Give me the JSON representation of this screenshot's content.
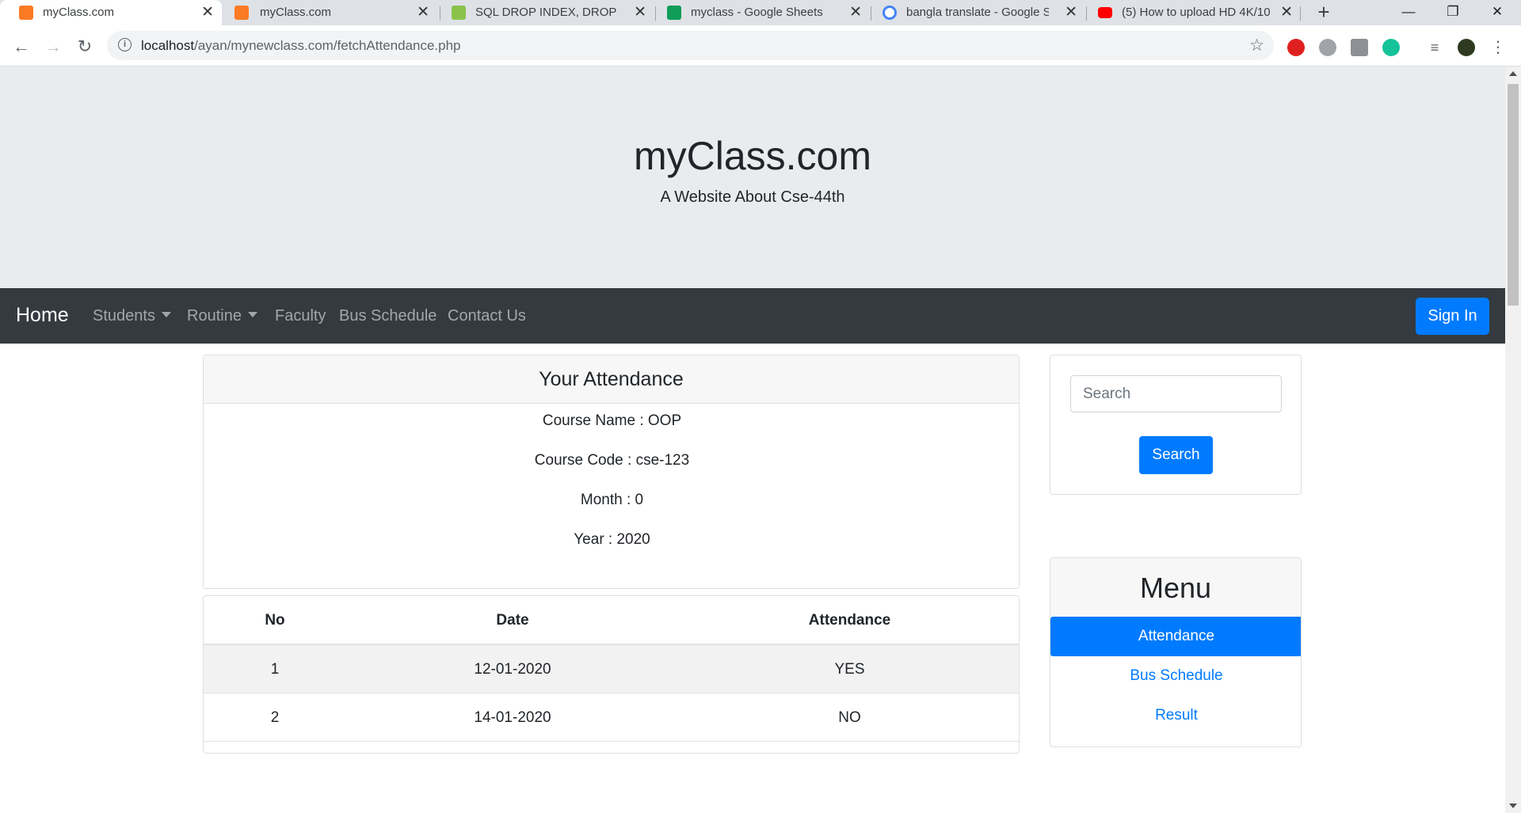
{
  "browser": {
    "tabs": [
      {
        "title": "myClass.com",
        "icon": "xampp-icon",
        "color": "#fb7a24"
      },
      {
        "title": "myClass.com",
        "icon": "xampp-icon",
        "color": "#fb7a24"
      },
      {
        "title": "SQL DROP INDEX, DROP TAB",
        "icon": "w3schools-icon",
        "color": "#8bc34a"
      },
      {
        "title": "myclass - Google Sheets",
        "icon": "sheets-icon",
        "color": "#0f9d58"
      },
      {
        "title": "bangla translate - Google Se",
        "icon": "google-icon",
        "color": "#4285f4"
      },
      {
        "title": "(5) How to upload HD 4K/10",
        "icon": "youtube-icon",
        "color": "#ff0000"
      }
    ],
    "url_host": "localhost",
    "url_path": "/ayan/mynewclass.com/fetchAttendance.php"
  },
  "site": {
    "title": "myClass.com",
    "subtitle": "A Website About Cse-44th"
  },
  "nav": {
    "brand": "Home",
    "links": [
      "Students",
      "Routine",
      "Faculty",
      "Bus Schedule",
      "Contact Us"
    ],
    "signin": "Sign In"
  },
  "attendance": {
    "heading": "Your Attendance",
    "course_name": "Course Name : OOP",
    "course_code": "Course Code : cse-123",
    "month": "Month : 0",
    "year": "Year : 2020"
  },
  "table": {
    "headers": [
      "No",
      "Date",
      "Attendance"
    ],
    "rows": [
      [
        "1",
        "12-01-2020",
        "YES"
      ],
      [
        "2",
        "14-01-2020",
        "NO"
      ]
    ]
  },
  "search": {
    "placeholder": "Search",
    "button": "Search"
  },
  "menu": {
    "heading": "Menu",
    "items": [
      "Attendance",
      "Bus Schedule",
      "Result"
    ]
  },
  "colors": {
    "primary": "#007bff",
    "navbar": "#343a40",
    "jumbotron": "#e9ecef"
  }
}
